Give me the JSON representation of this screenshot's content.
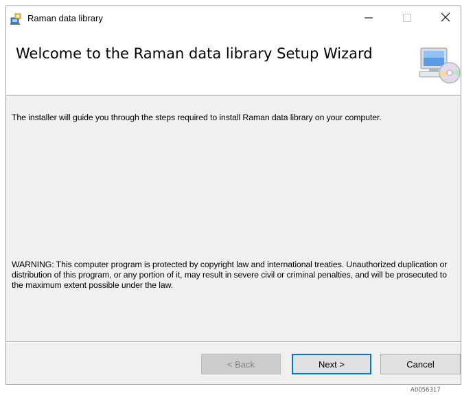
{
  "window": {
    "title": "Raman data library",
    "controls": {
      "minimize": "minimize-icon",
      "maximize": "maximize-icon",
      "close": "close-icon"
    }
  },
  "header": {
    "title": "Welcome to the Raman data library Setup Wizard",
    "icon": "computer-cd-icon"
  },
  "body": {
    "intro": "The installer will guide you through the steps required to install Raman data library on your computer.",
    "warning": "WARNING: This computer program is protected by copyright law and international treaties. Unauthorized duplication or distribution of this program, or any portion of it, may result in severe civil or criminal penalties, and will be prosecuted to the maximum extent possible under the law."
  },
  "buttons": {
    "back": "< Back",
    "next": "Next >",
    "cancel": "Cancel"
  },
  "footnote": "A0056317",
  "colors": {
    "accent": "#0078d7",
    "dialog_bg": "#f0f0f0"
  }
}
